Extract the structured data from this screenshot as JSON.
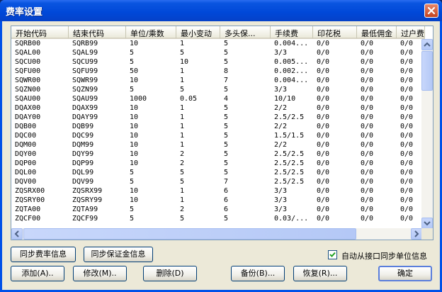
{
  "window": {
    "title": "费率设置"
  },
  "table": {
    "columns": [
      "开始代码",
      "结束代码",
      "单位/乘数",
      "最小变动",
      "多头保...",
      "手续费",
      "印花税",
      "最低佣金",
      "过户费"
    ],
    "rows": [
      [
        "SQRB00",
        "SQRB99",
        "10",
        "1",
        "5",
        "0.004...",
        "0/0",
        "0/0",
        "0/0"
      ],
      [
        "SQAL00",
        "SQAL99",
        "5",
        "5",
        "5",
        "3/3",
        "0/0",
        "0/0",
        "0/0"
      ],
      [
        "SQCU00",
        "SQCU99",
        "5",
        "10",
        "5",
        "0.005...",
        "0/0",
        "0/0",
        "0/0"
      ],
      [
        "SQFU00",
        "SQFU99",
        "50",
        "1",
        "8",
        "0.002...",
        "0/0",
        "0/0",
        "0/0"
      ],
      [
        "SQWR00",
        "SQWR99",
        "10",
        "1",
        "7",
        "0.004...",
        "0/0",
        "0/0",
        "0/0"
      ],
      [
        "SQZN00",
        "SQZN99",
        "5",
        "5",
        "5",
        "3/3",
        "0/0",
        "0/0",
        "0/0"
      ],
      [
        "SQAU00",
        "SQAU99",
        "1000",
        "0.05",
        "4",
        "10/10",
        "0/0",
        "0/0",
        "0/0"
      ],
      [
        "DQAX00",
        "DQAX99",
        "10",
        "1",
        "5",
        "2/2",
        "0/0",
        "0/0",
        "0/0"
      ],
      [
        "DQAY00",
        "DQAY99",
        "10",
        "1",
        "5",
        "2.5/2.5",
        "0/0",
        "0/0",
        "0/0"
      ],
      [
        "DQB00",
        "DQB99",
        "10",
        "1",
        "5",
        "2/2",
        "0/0",
        "0/0",
        "0/0"
      ],
      [
        "DQC00",
        "DQC99",
        "10",
        "1",
        "5",
        "1.5/1.5",
        "0/0",
        "0/0",
        "0/0"
      ],
      [
        "DQM00",
        "DQM99",
        "10",
        "1",
        "5",
        "2/2",
        "0/0",
        "0/0",
        "0/0"
      ],
      [
        "DQY00",
        "DQY99",
        "10",
        "2",
        "5",
        "2.5/2.5",
        "0/0",
        "0/0",
        "0/0"
      ],
      [
        "DQP00",
        "DQP99",
        "10",
        "2",
        "5",
        "2.5/2.5",
        "0/0",
        "0/0",
        "0/0"
      ],
      [
        "DQL00",
        "DQL99",
        "5",
        "5",
        "5",
        "2.5/2.5",
        "0/0",
        "0/0",
        "0/0"
      ],
      [
        "DQV00",
        "DQV99",
        "5",
        "5",
        "7",
        "2.5/2.5",
        "0/0",
        "0/0",
        "0/0"
      ],
      [
        "ZQSRX00",
        "ZQSRX99",
        "10",
        "1",
        "6",
        "3/3",
        "0/0",
        "0/0",
        "0/0"
      ],
      [
        "ZQSRY00",
        "ZQSRY99",
        "10",
        "1",
        "6",
        "3/3",
        "0/0",
        "0/0",
        "0/0"
      ],
      [
        "ZQTA00",
        "ZQTA99",
        "5",
        "2",
        "6",
        "3/3",
        "0/0",
        "0/0",
        "0/0"
      ],
      [
        "ZQCF00",
        "ZQCF99",
        "5",
        "5",
        "5",
        "0.03/...",
        "0/0",
        "0/0",
        "0/0"
      ]
    ]
  },
  "buttons": {
    "sync_fee": "同步费率信息",
    "sync_margin": "同步保证金信息",
    "add": "添加(A)..",
    "modify": "修改(M)..",
    "delete": "删除(D)",
    "backup": "备份(B)...",
    "restore": "恢复(R)...",
    "ok": "确定"
  },
  "auto_sync": {
    "label": "自动从接口同步单位信息",
    "checked": true
  },
  "icons": {
    "close": "close-icon",
    "check": "checkmark-icon"
  }
}
